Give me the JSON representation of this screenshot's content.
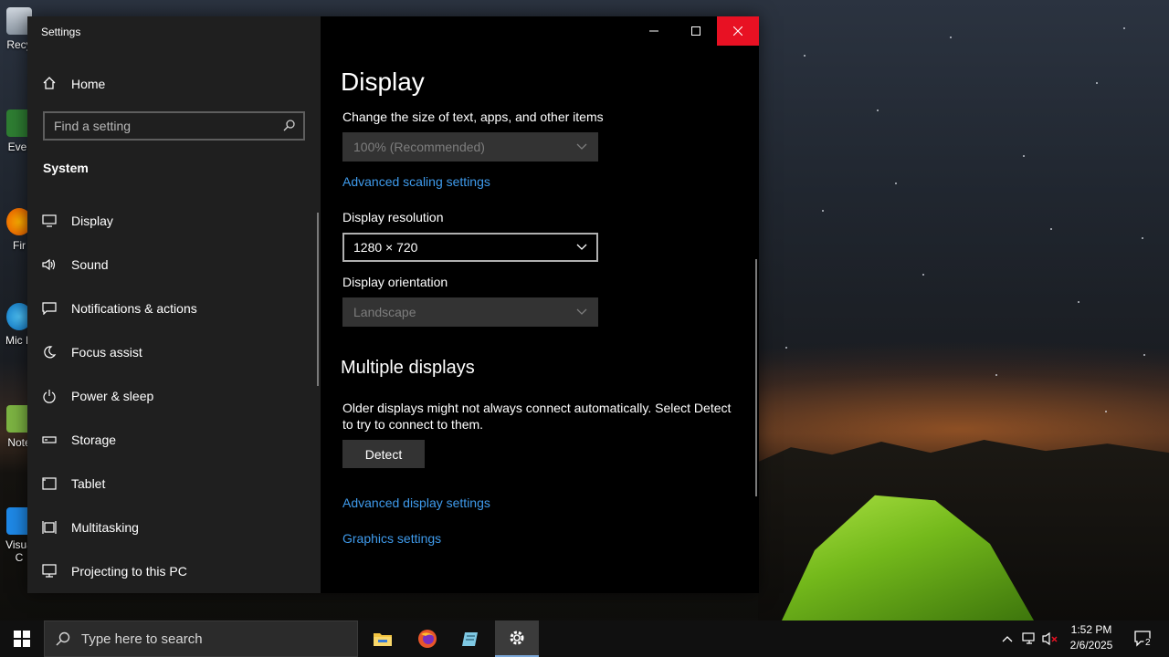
{
  "desktop": {
    "icons": [
      {
        "label": "Recy"
      },
      {
        "label": "Ever"
      },
      {
        "label": "Fir"
      },
      {
        "label": "Mic E"
      },
      {
        "label": "Note"
      },
      {
        "label": "Visua C"
      }
    ]
  },
  "window": {
    "title": "Settings",
    "controls": {
      "minimize": "minimize",
      "maximize": "maximize",
      "close": "close"
    }
  },
  "nav": {
    "home_label": "Home",
    "search_placeholder": "Find a setting",
    "section_label": "System",
    "items": [
      {
        "label": "Display",
        "icon": "monitor-icon"
      },
      {
        "label": "Sound",
        "icon": "speaker-icon"
      },
      {
        "label": "Notifications & actions",
        "icon": "notification-icon"
      },
      {
        "label": "Focus assist",
        "icon": "moon-icon"
      },
      {
        "label": "Power & sleep",
        "icon": "power-icon"
      },
      {
        "label": "Storage",
        "icon": "storage-icon"
      },
      {
        "label": "Tablet",
        "icon": "tablet-icon"
      },
      {
        "label": "Multitasking",
        "icon": "multitasking-icon"
      },
      {
        "label": "Projecting to this PC",
        "icon": "projecting-icon"
      }
    ]
  },
  "content": {
    "page_title": "Display",
    "scale_label": "Change the size of text, apps, and other items",
    "scale_value": "100% (Recommended)",
    "advanced_scaling_link": "Advanced scaling settings",
    "resolution_label": "Display resolution",
    "resolution_value": "1280 × 720",
    "orientation_label": "Display orientation",
    "orientation_value": "Landscape",
    "multiple_displays_title": "Multiple displays",
    "multiple_displays_desc": "Older displays might not always connect automatically. Select Detect to try to connect to them.",
    "detect_button": "Detect",
    "advanced_display_link": "Advanced display settings",
    "graphics_link": "Graphics settings"
  },
  "taskbar": {
    "search_placeholder": "Type here to search",
    "apps": [
      "file-explorer-icon",
      "firefox-icon",
      "notepad-icon",
      "settings-icon"
    ],
    "clock_time": "1:52 PM",
    "clock_date": "2/6/2025",
    "notification_count": "2",
    "colors": {
      "accent_link": "#3f9bec",
      "close": "#e81123"
    }
  }
}
